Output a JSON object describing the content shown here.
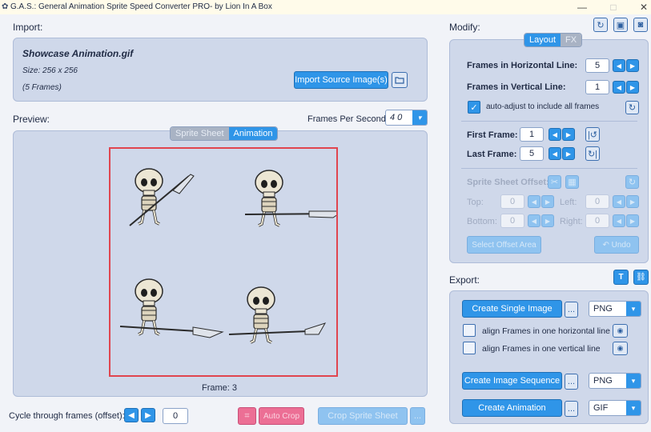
{
  "window": {
    "title": "G.A.S.: General Animation Sprite Speed Converter PRO- by Lion In A Box",
    "minimize": "—",
    "maximize": "□",
    "close": "✕"
  },
  "import": {
    "section_label": "Import:",
    "filename": "Showcase Animation.gif",
    "size": "Size: 256 x 256",
    "frames": "(5 Frames)",
    "import_button": "Import Source Image(s)"
  },
  "preview": {
    "section_label": "Preview:",
    "fps_label": "Frames Per Second:",
    "fps_value": "4 0",
    "tab_sprite_sheet": "Sprite Sheet",
    "tab_animation": "Animation",
    "frame_label": "Frame: 3",
    "cycle_label": "Cycle through frames (offset):",
    "cycle_value": "0",
    "auto_crop": "Auto Crop",
    "crop_sprite_sheet": "Crop Sprite Sheet"
  },
  "modify": {
    "section_label": "Modify:",
    "tab_layout": "Layout",
    "tab_fx": "FX",
    "frames_h_label": "Frames in Horizontal Line:",
    "frames_h_value": "5",
    "frames_v_label": "Frames in Vertical Line:",
    "frames_v_value": "1",
    "auto_adjust": "auto-adjust to include all frames",
    "first_frame_label": "First Frame:",
    "first_frame_value": "1",
    "last_frame_label": "Last Frame:",
    "last_frame_value": "5",
    "offset_label": "Sprite Sheet Offset:",
    "top_label": "Top:",
    "top_value": "0",
    "left_label": "Left:",
    "left_value": "0",
    "bottom_label": "Bottom:",
    "bottom_value": "0",
    "right_label": "Right:",
    "right_value": "0",
    "select_offset_area": "Select Offset Area",
    "undo": "↶ Undo"
  },
  "export": {
    "section_label": "Export:",
    "create_single_image": "Create Single Image",
    "single_format": "PNG",
    "align_horizontal": "align Frames in one horizontal line",
    "align_vertical": "align Frames in one vertical line",
    "create_image_sequence": "Create Image Sequence",
    "sequence_format": "PNG",
    "create_animation": "Create Animation",
    "animation_format": "GIF"
  },
  "common": {
    "more": "...",
    "arrow_left": "◀",
    "arrow_right": "▶",
    "dropdown": "▾",
    "check": "✓"
  },
  "colors": {
    "accent": "#2f95e8",
    "panel": "#cfd8ea",
    "frame_border": "#e0454f",
    "pink": "#ec6f95"
  }
}
